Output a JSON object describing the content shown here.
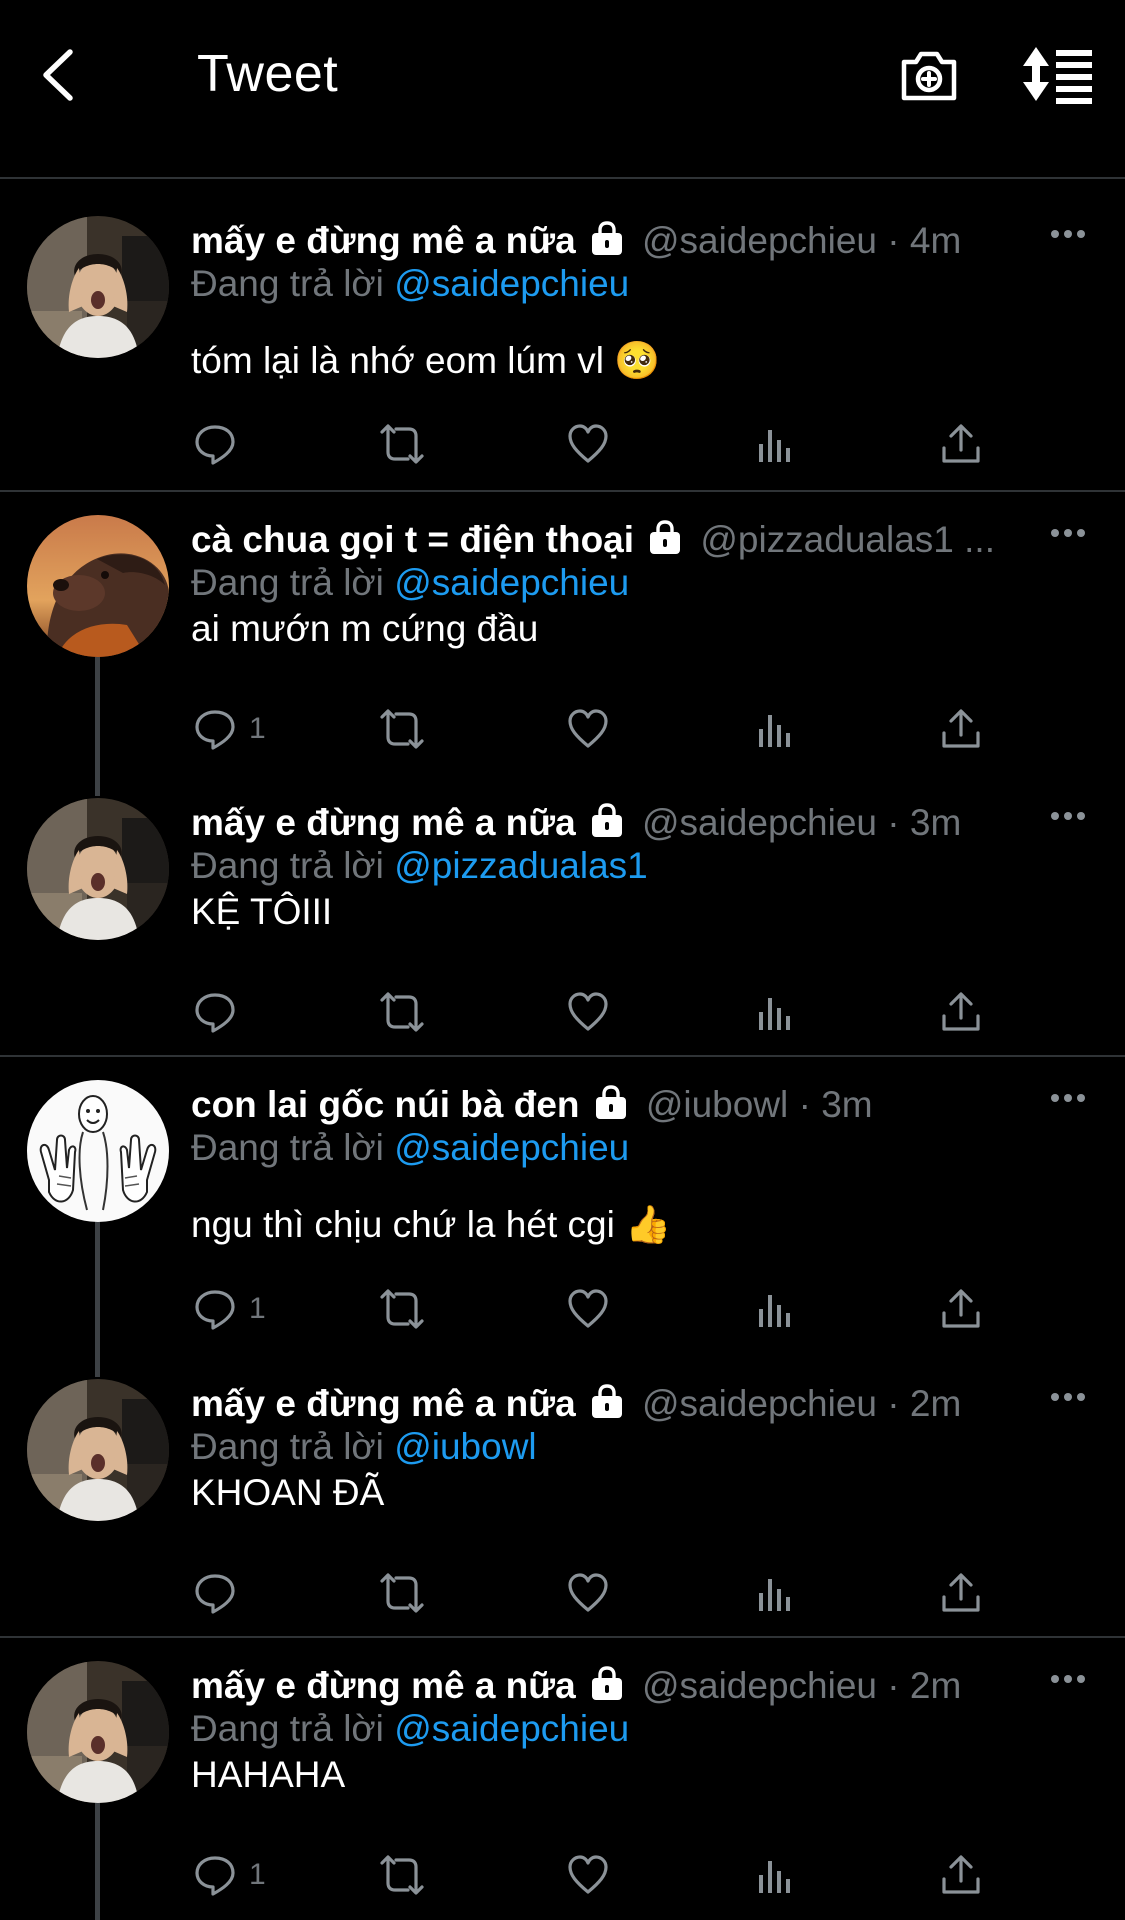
{
  "header": {
    "title": "Tweet",
    "back_icon": "chevron-left-icon",
    "camera_icon": "camera-plus-icon",
    "sort_icon": "sort-list-icon"
  },
  "colors": {
    "background": "#000000",
    "text": "#ffffff",
    "muted": "#71767b",
    "link": "#1d9bf0",
    "divider": "#2f3336"
  },
  "tweets": [
    {
      "name": "mấy e đừng mê a nữa",
      "handle": "@saidepchieu",
      "dot": "·",
      "time": "4m",
      "reply_label": "Đang trả lời",
      "reply_to": "@saidepchieu",
      "text": "tóm lại là nhớ eom lúm vl 🥺",
      "reply_count": ""
    },
    {
      "name": "cà chua gọi t = điện thoại",
      "handle": "@pizzadualas1 ...",
      "dot": "",
      "time": "",
      "reply_label": "Đang trả lời",
      "reply_to": "@saidepchieu",
      "text": "ai mướn m cứng đầu",
      "reply_count": "1"
    },
    {
      "name": "mấy e đừng mê a nữa",
      "handle": "@saidepchieu",
      "dot": "·",
      "time": "3m",
      "reply_label": "Đang trả lời",
      "reply_to": "@pizzadualas1",
      "text": "KỆ TÔIII",
      "reply_count": ""
    },
    {
      "name": "con lai gốc núi bà đen",
      "handle": "@iubowl",
      "dot": "·",
      "time": "3m",
      "reply_label": "Đang trả lời",
      "reply_to": "@saidepchieu",
      "text": "ngu thì chịu chứ la hét cgi 👍",
      "reply_count": "1"
    },
    {
      "name": "mấy e đừng mê a nữa",
      "handle": "@saidepchieu",
      "dot": "·",
      "time": "2m",
      "reply_label": "Đang trả lời",
      "reply_to": "@iubowl",
      "text": "KHOAN ĐÃ",
      "reply_count": ""
    },
    {
      "name": "mấy e đừng mê a nữa",
      "handle": "@saidepchieu",
      "dot": "·",
      "time": "2m",
      "reply_label": "Đang trả lời",
      "reply_to": "@saidepchieu",
      "text": "HAHAHA",
      "reply_count": "1"
    }
  ]
}
